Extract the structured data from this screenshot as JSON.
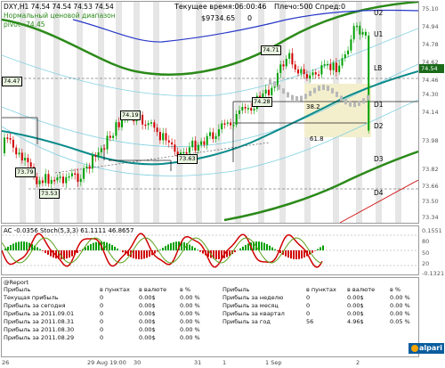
{
  "header": {
    "symbol_line": "DXY,H1  74.54 74.54 74.53 74.54",
    "indicator_line": "Нормальный ценовой диапазон",
    "pivot_line": "pivot=74.45",
    "server_time": "Текущее время:06:00:46",
    "leverage": "Плечо:500",
    "spread": "Спред:0",
    "balance": "$9734.65",
    "spread_value": "0"
  },
  "levels": [
    "U2",
    "U1",
    "LB",
    "D1",
    "D2",
    "D3",
    "D4"
  ],
  "price_scale": [
    "75.10",
    "74.94",
    "74.78",
    "74.62",
    "74.46",
    "74.30",
    "74.14",
    "73.98",
    "73.82",
    "73.66",
    "73.50",
    "73.34"
  ],
  "current_price": "74.54",
  "price_tags": [
    "74.71",
    "74.28",
    "74.19",
    "73.79",
    "73.63",
    "73.53",
    "74.47"
  ],
  "fib_labels": [
    "38.2",
    "61.8"
  ],
  "indicators": {
    "title": "AC -0.0356  Stoch(5,3,3) 61.1111 46.8657",
    "scale": [
      "0.1551",
      "80",
      "50",
      "20",
      "-0.1321"
    ]
  },
  "report": {
    "title": "@Report",
    "left_headers": [
      "Прибыль",
      "в пунктах",
      "в валюте",
      "в %"
    ],
    "left_rows": [
      [
        "Текущая прибыль",
        "0",
        "0.00$",
        "0.00 %"
      ],
      [
        "Прибыль за сегодня",
        "0",
        "0.00$",
        "0.00 %"
      ],
      [
        "Прибыль за 2011.09.01",
        "0",
        "0.00$",
        "0.00 %"
      ],
      [
        "Прибыль за 2011.08.31",
        "0",
        "0.00$",
        "0.00 %"
      ],
      [
        "Прибыль за 2011.08.30",
        "0",
        "0.00$",
        "0.00 %"
      ],
      [
        "Прибыль за 2011.08.29",
        "0",
        "0.00$",
        "0.00 %"
      ]
    ],
    "right_headers": [
      "Прибыль",
      "в пунктах",
      "в валюте",
      "в %"
    ],
    "right_rows": [
      [
        "Прибыль за неделю",
        "0",
        "0.00$",
        "0.00 %"
      ],
      [
        "Прибыль за месяц",
        "0",
        "0.00$",
        "0.00 %"
      ],
      [
        "Прибыль за квартал",
        "0",
        "0.00$",
        "0.00 %"
      ],
      [
        "Прибыль за год",
        "56",
        "4.96$",
        "0.05 %"
      ]
    ]
  },
  "time_axis": [
    "26",
    "29 Aug 19:00",
    "30",
    "31",
    "1",
    "1 Sep",
    "2"
  ],
  "logo": "alpari",
  "colors": {
    "bull": "#00a000",
    "bear": "#d00000",
    "band_green": "#2c8a1a",
    "band_blue": "#2838c8",
    "ma_teal": "#0a8a8a",
    "fib_fill": "#f3efcd"
  }
}
